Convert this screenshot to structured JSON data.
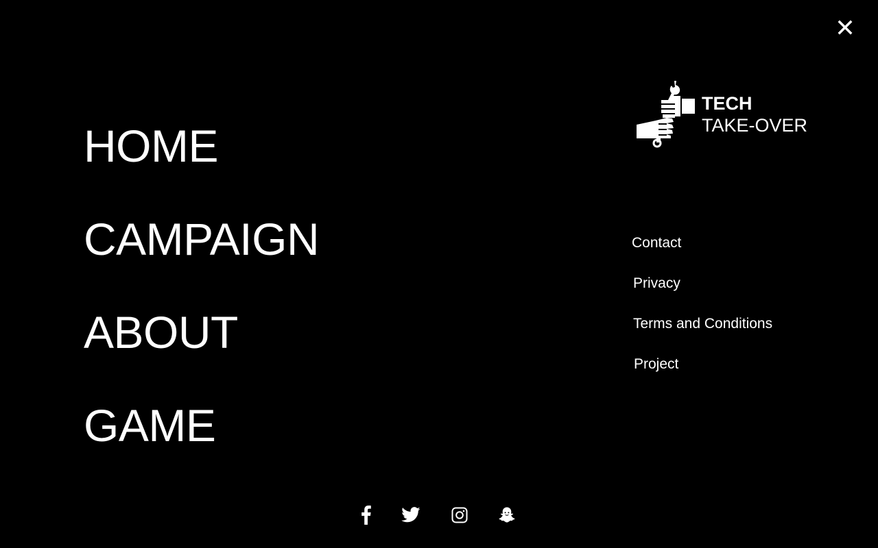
{
  "close": {
    "icon": "close-icon"
  },
  "main_nav": {
    "items": [
      {
        "label": "HOME"
      },
      {
        "label": "CAMPAIGN"
      },
      {
        "label": "ABOUT"
      },
      {
        "label": "GAME"
      }
    ]
  },
  "logo": {
    "icon": "wrench-hands-logo-icon",
    "line1": "TECH",
    "line2": "TAKE-OVER"
  },
  "secondary_nav": {
    "items": [
      {
        "label": "Contact"
      },
      {
        "label": "Privacy"
      },
      {
        "label": "Terms and Conditions"
      },
      {
        "label": "Project"
      }
    ]
  },
  "social": {
    "icons": [
      "facebook-icon",
      "twitter-icon",
      "instagram-icon",
      "snapchat-icon"
    ]
  },
  "colors": {
    "background": "#000000",
    "foreground": "#ffffff"
  }
}
